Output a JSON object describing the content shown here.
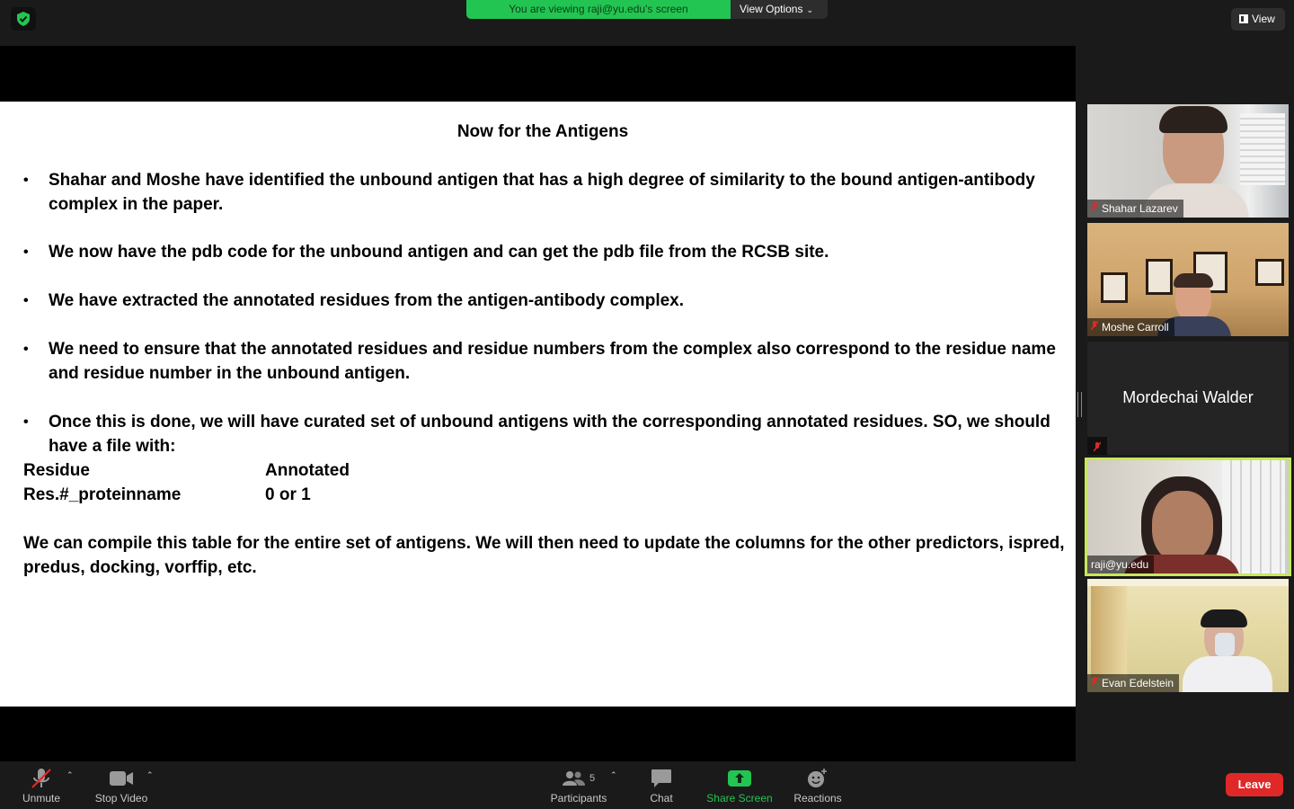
{
  "top_bar": {
    "viewing_banner": "You are viewing raji@yu.edu's screen",
    "view_options_label": "View Options",
    "view_label": "View"
  },
  "slide": {
    "title": "Now for the Antigens",
    "bullets": [
      "Shahar and Moshe have identified the unbound antigen that has a high degree of similarity to the bound antigen-antibody complex in the paper.",
      "We now have the pdb code for the unbound antigen and can get the pdb file from the RCSB site.",
      "We have extracted the annotated residues from the antigen-antibody complex.",
      "We need to ensure that the annotated residues and residue numbers from the complex also correspond to the residue name and residue number in the unbound antigen.",
      "Once this is done, we will have curated set of unbound antigens with the corresponding annotated residues.  SO, we should have a file with:"
    ],
    "table": [
      [
        "Residue",
        "Annotated"
      ],
      [
        "Res.#_proteinname",
        "0 or 1"
      ]
    ],
    "closing": "We can compile this table for the entire set of antigens.  We will then need to update the columns for the other predictors, ispred, predus, docking, vorffip, etc."
  },
  "participants": [
    {
      "name": "Shahar Lazarev",
      "video": true
    },
    {
      "name": "Moshe Carroll",
      "video": true
    },
    {
      "name": "Mordechai Walder",
      "video": false
    },
    {
      "name": "raji@yu.edu",
      "video": true
    },
    {
      "name": "Evan Edelstein",
      "video": true
    }
  ],
  "toolbar": {
    "unmute_label": "Unmute",
    "stop_video_label": "Stop Video",
    "participants_label": "Participants",
    "participants_count": "5",
    "chat_label": "Chat",
    "share_screen_label": "Share Screen",
    "reactions_label": "Reactions",
    "leave_label": "Leave"
  },
  "colors": {
    "banner_green": "#23c552",
    "leave_red": "#e02828",
    "active_speaker": "#c7e85a"
  }
}
